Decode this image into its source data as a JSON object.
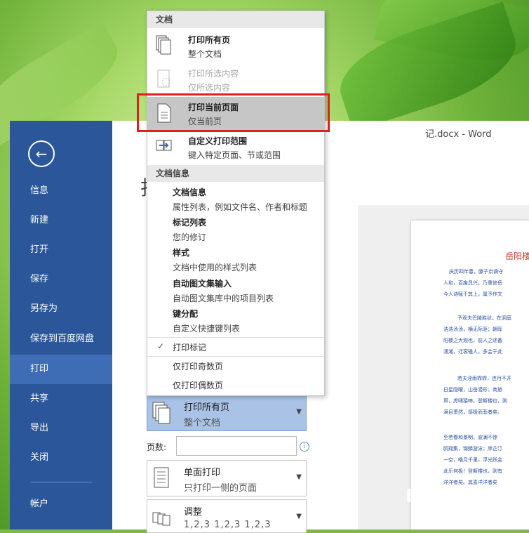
{
  "window": {
    "title_fragment": "记.docx - Word"
  },
  "page_title_fragment": "打",
  "backstage": {
    "items": [
      {
        "label": "信息"
      },
      {
        "label": "新建"
      },
      {
        "label": "打开"
      },
      {
        "label": "保存"
      },
      {
        "label": "另存为"
      },
      {
        "label": "保存到百度网盘"
      },
      {
        "label": "打印",
        "active": true
      },
      {
        "label": "共享"
      },
      {
        "label": "导出"
      },
      {
        "label": "关闭"
      },
      {
        "label": "帐户"
      }
    ]
  },
  "menu": {
    "section_doc": "文档",
    "print_all": {
      "title": "打印所有页",
      "sub": "整个文档"
    },
    "print_selection": {
      "title": "打印所选内容",
      "sub": "仅所选内容"
    },
    "print_current": {
      "title": "打印当前页面",
      "sub": "仅当前页"
    },
    "custom_range": {
      "title": "自定义打印范围",
      "sub": "键入特定页面、节或范围"
    },
    "section_info": "文档信息",
    "info_items": [
      {
        "title": "文档信息",
        "sub": "属性列表，例如文件名、作者和标题"
      },
      {
        "title": "标记列表",
        "sub": "您的修订"
      },
      {
        "title": "样式",
        "sub": "文档中使用的样式列表"
      },
      {
        "title": "自动图文集输入",
        "sub": "自动图文集库中的项目列表"
      },
      {
        "title": "键分配",
        "sub": "自定义快捷键列表"
      }
    ],
    "print_markup": "打印标记",
    "check_mark": "✓",
    "odd_pages": "仅打印奇数页",
    "even_pages": "仅打印偶数页"
  },
  "settings": {
    "pages_selector": {
      "title": "打印所有页",
      "sub": "整个文档"
    },
    "pages_label": "页数:",
    "pages_value": "",
    "sides": {
      "title": "单面打印",
      "sub": "只打印一侧的页面"
    },
    "collate": {
      "title": "调整",
      "sub": "1,2,3   1,2,3   1,2,3"
    }
  },
  "preview": {
    "doc_title": "岳阳楼",
    "lines": [
      "庆历四年春，滕子京谪守",
      "人和，百废具兴。乃重修岳",
      "今人诗赋于其上。属予作文",
      "予观夫巴陵胜状，在洞庭",
      "浩浩汤汤，横无际涯；朝晖",
      "阳楼之大观也，前人之述备",
      "潇湘，迁客骚人，多会于此",
      "若夫淫雨霏霏，连月不开",
      "日星隐曜，山岳潜形；商旅",
      "冥，虎啸猿啼。登斯楼也，则",
      "满目萧然，感极而悲者矣。",
      "至若春和景明，波澜不惊",
      "鸥翔集，锦鳞游泳；岸芷汀",
      "一空，皓月千里，浮光跃金",
      "此乐何极！登斯楼也，则有",
      "洋洋者矣。其喜洋洋者矣"
    ]
  },
  "watermark": {
    "text": "Bai 经验",
    "sub": "jingyan.baidu.com"
  }
}
